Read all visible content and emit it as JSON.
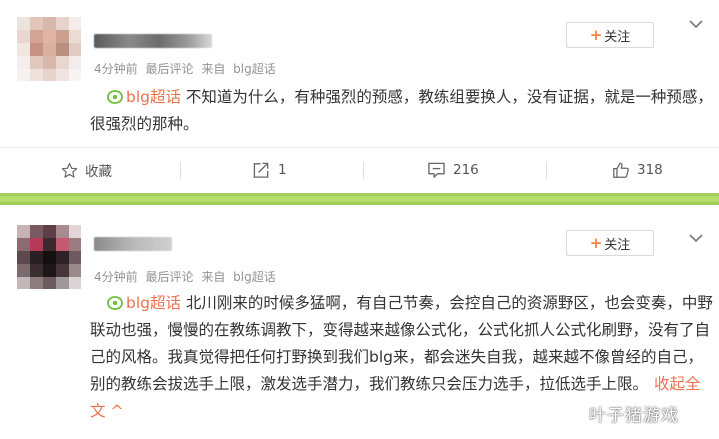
{
  "posts": [
    {
      "meta": {
        "time": "4分钟前",
        "sort": "最后评论",
        "source_prefix": "来自",
        "source": "blg超话"
      },
      "follow_label": "关注",
      "topic": "blg超话",
      "text": "不知道为什么，有种强烈的预感，教练组要换人，没有证据，就是一种预感，很强烈的那种。",
      "actions": {
        "favorite_label": "收藏",
        "repost_count": "1",
        "comment_count": "216",
        "like_count": "318"
      }
    },
    {
      "meta": {
        "time": "4分钟前",
        "sort": "最后评论",
        "source_prefix": "来自",
        "source": "blg超话"
      },
      "follow_label": "关注",
      "topic": "blg超话",
      "text": "北川刚来的时候多猛啊，有自己节奏，会控自己的资源野区，也会变奏，中野联动也强，慢慢的在教练调教下，变得越来越像公式化，公式化抓人公式化刷野，没有了自己的风格。我真觉得把任何打野换到我们blg来，都会迷失自我，越来越不像曾经的自己，别的教练会拔选手上限，激发选手潜力，我们教练只会压力选手，拉低选手上限。",
      "fold_label": "收起全文",
      "fold_arrow": "^"
    }
  ],
  "watermark": "叶子猪游戏",
  "colors": {
    "accent": "#eb7350",
    "topic_icon": "#6cbf3a",
    "separator": "#9fcf5a",
    "follow_plus": "#ff8140"
  },
  "icons": [
    "topic-icon",
    "star-icon",
    "repost-icon",
    "comment-icon",
    "like-icon",
    "chevron-down-icon"
  ]
}
